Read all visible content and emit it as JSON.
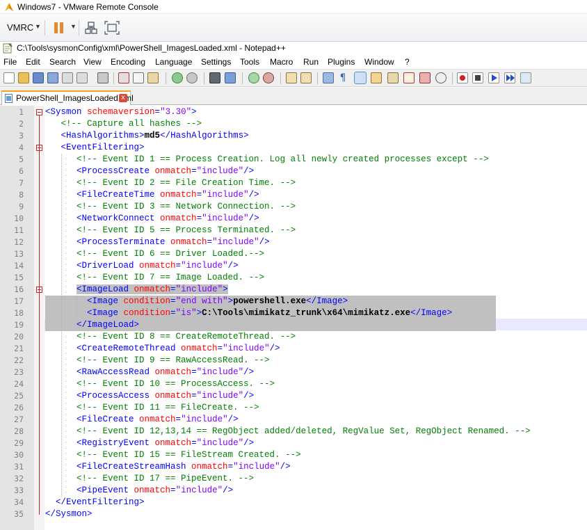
{
  "vm": {
    "title": "Windows7 - VMware Remote Console",
    "menu_label": "VMRC"
  },
  "npp": {
    "title": "C:\\Tools\\sysmonConfig\\xml\\PowerShell_ImagesLoaded.xml - Notepad++",
    "menu": [
      "File",
      "Edit",
      "Search",
      "View",
      "Encoding",
      "Language",
      "Settings",
      "Tools",
      "Macro",
      "Run",
      "Plugins",
      "Window",
      "?"
    ],
    "tab_label": "PowerShell_ImagesLoaded.xml",
    "tab_close": "x"
  },
  "colors": {
    "tag": "#0000ff",
    "attr": "#ff0000",
    "string": "#8000ff",
    "comment": "#008000",
    "selection": "#c0c0c0",
    "current_line": "#e8e8ff"
  },
  "editor": {
    "lines": [
      {
        "n": "1",
        "indent": 0,
        "segs": [
          [
            "t",
            "<Sysmon "
          ],
          [
            "a",
            "schemaversion"
          ],
          [
            "t",
            "="
          ],
          [
            "s",
            "\"3.30\""
          ],
          [
            "t",
            ">"
          ]
        ]
      },
      {
        "n": "2",
        "indent": 3,
        "segs": [
          [
            "c",
            "<!-- Capture all hashes -->"
          ]
        ]
      },
      {
        "n": "3",
        "indent": 3,
        "segs": [
          [
            "t",
            "<HashAlgorithms>"
          ],
          [
            "x",
            "md5"
          ],
          [
            "t",
            "</HashAlgorithms>"
          ]
        ]
      },
      {
        "n": "4",
        "indent": 3,
        "segs": [
          [
            "t",
            "<EventFiltering>"
          ]
        ]
      },
      {
        "n": "5",
        "indent": 6,
        "segs": [
          [
            "c",
            "<!-- Event ID 1 == Process Creation. Log all newly created processes except -->"
          ]
        ]
      },
      {
        "n": "6",
        "indent": 6,
        "segs": [
          [
            "t",
            "<ProcessCreate "
          ],
          [
            "a",
            "onmatch"
          ],
          [
            "t",
            "="
          ],
          [
            "s",
            "\"include\""
          ],
          [
            "t",
            "/>"
          ]
        ]
      },
      {
        "n": "7",
        "indent": 6,
        "segs": [
          [
            "c",
            "<!-- Event ID 2 == File Creation Time. -->"
          ]
        ]
      },
      {
        "n": "8",
        "indent": 6,
        "segs": [
          [
            "t",
            "<FileCreateTime "
          ],
          [
            "a",
            "onmatch"
          ],
          [
            "t",
            "="
          ],
          [
            "s",
            "\"include\""
          ],
          [
            "t",
            "/>"
          ]
        ]
      },
      {
        "n": "9",
        "indent": 6,
        "segs": [
          [
            "c",
            "<!-- Event ID 3 == Network Connection. -->"
          ]
        ]
      },
      {
        "n": "10",
        "indent": 6,
        "segs": [
          [
            "t",
            "<NetworkConnect "
          ],
          [
            "a",
            "onmatch"
          ],
          [
            "t",
            "="
          ],
          [
            "s",
            "\"include\""
          ],
          [
            "t",
            "/>"
          ]
        ]
      },
      {
        "n": "11",
        "indent": 6,
        "segs": [
          [
            "c",
            "<!-- Event ID 5 == Process Terminated. -->"
          ]
        ]
      },
      {
        "n": "12",
        "indent": 6,
        "segs": [
          [
            "t",
            "<ProcessTerminate "
          ],
          [
            "a",
            "onmatch"
          ],
          [
            "t",
            "="
          ],
          [
            "s",
            "\"include\""
          ],
          [
            "t",
            "/>"
          ]
        ]
      },
      {
        "n": "13",
        "indent": 6,
        "segs": [
          [
            "c",
            "<!-- Event ID 6 == Driver Loaded.-->"
          ]
        ]
      },
      {
        "n": "14",
        "indent": 6,
        "segs": [
          [
            "t",
            "<DriverLoad "
          ],
          [
            "a",
            "onmatch"
          ],
          [
            "t",
            "="
          ],
          [
            "s",
            "\"include\""
          ],
          [
            "t",
            "/>"
          ]
        ]
      },
      {
        "n": "15",
        "indent": 6,
        "segs": [
          [
            "c",
            "<!-- Event ID 7 == Image Loaded. -->"
          ]
        ]
      },
      {
        "n": "16",
        "indent": 6,
        "sel": "text",
        "segs": [
          [
            "t",
            "<ImageLoad "
          ],
          [
            "a",
            "onmatch"
          ],
          [
            "t",
            "="
          ],
          [
            "s",
            "\"include\""
          ],
          [
            "t",
            ">"
          ]
        ]
      },
      {
        "n": "17",
        "indent": 0,
        "sel": "full",
        "segs": [
          [
            "x",
            "        "
          ],
          [
            "t",
            "<Image "
          ],
          [
            "a",
            "condition"
          ],
          [
            "t",
            "="
          ],
          [
            "s",
            "\"end with\""
          ],
          [
            "t",
            ">"
          ],
          [
            "x",
            "powershell.exe"
          ],
          [
            "t",
            "</Image>"
          ]
        ]
      },
      {
        "n": "18",
        "indent": 0,
        "sel": "full",
        "segs": [
          [
            "x",
            "        "
          ],
          [
            "t",
            "<Image "
          ],
          [
            "a",
            "condition"
          ],
          [
            "t",
            "="
          ],
          [
            "s",
            "\"is\""
          ],
          [
            "t",
            ">"
          ],
          [
            "x",
            "C:\\Tools\\mimikatz_trunk\\x64\\mimikatz.exe"
          ],
          [
            "t",
            "</Image>"
          ]
        ]
      },
      {
        "n": "19",
        "indent": 0,
        "sel": "full",
        "segs": [
          [
            "x",
            "      "
          ],
          [
            "t",
            "</ImageLoad>"
          ]
        ]
      },
      {
        "n": "20",
        "indent": 6,
        "segs": [
          [
            "c",
            "<!-- Event ID 8 == CreateRemoteThread. -->"
          ]
        ]
      },
      {
        "n": "21",
        "indent": 6,
        "segs": [
          [
            "t",
            "<CreateRemoteThread "
          ],
          [
            "a",
            "onmatch"
          ],
          [
            "t",
            "="
          ],
          [
            "s",
            "\"include\""
          ],
          [
            "t",
            "/>"
          ]
        ]
      },
      {
        "n": "22",
        "indent": 6,
        "segs": [
          [
            "c",
            "<!-- Event ID 9 == RawAccessRead. -->"
          ]
        ]
      },
      {
        "n": "23",
        "indent": 6,
        "segs": [
          [
            "t",
            "<RawAccessRead "
          ],
          [
            "a",
            "onmatch"
          ],
          [
            "t",
            "="
          ],
          [
            "s",
            "\"include\""
          ],
          [
            "t",
            "/>"
          ]
        ]
      },
      {
        "n": "24",
        "indent": 6,
        "segs": [
          [
            "c",
            "<!-- Event ID 10 == ProcessAccess. -->"
          ]
        ]
      },
      {
        "n": "25",
        "indent": 6,
        "segs": [
          [
            "t",
            "<ProcessAccess "
          ],
          [
            "a",
            "onmatch"
          ],
          [
            "t",
            "="
          ],
          [
            "s",
            "\"include\""
          ],
          [
            "t",
            "/>"
          ]
        ]
      },
      {
        "n": "26",
        "indent": 6,
        "segs": [
          [
            "c",
            "<!-- Event ID 11 == FileCreate. -->"
          ]
        ]
      },
      {
        "n": "27",
        "indent": 6,
        "segs": [
          [
            "t",
            "<FileCreate "
          ],
          [
            "a",
            "onmatch"
          ],
          [
            "t",
            "="
          ],
          [
            "s",
            "\"include\""
          ],
          [
            "t",
            "/>"
          ]
        ]
      },
      {
        "n": "28",
        "indent": 6,
        "segs": [
          [
            "c",
            "<!-- Event ID 12,13,14 == RegObject added/deleted, RegValue Set, RegObject Renamed. -->"
          ]
        ]
      },
      {
        "n": "29",
        "indent": 6,
        "segs": [
          [
            "t",
            "<RegistryEvent "
          ],
          [
            "a",
            "onmatch"
          ],
          [
            "t",
            "="
          ],
          [
            "s",
            "\"include\""
          ],
          [
            "t",
            "/>"
          ]
        ]
      },
      {
        "n": "30",
        "indent": 6,
        "segs": [
          [
            "c",
            "<!-- Event ID 15 == FileStream Created. -->"
          ]
        ]
      },
      {
        "n": "31",
        "indent": 6,
        "segs": [
          [
            "t",
            "<FileCreateStreamHash "
          ],
          [
            "a",
            "onmatch"
          ],
          [
            "t",
            "="
          ],
          [
            "s",
            "\"include\""
          ],
          [
            "t",
            "/>"
          ]
        ]
      },
      {
        "n": "32",
        "indent": 6,
        "segs": [
          [
            "c",
            "<!-- Event ID 17 == PipeEvent. -->"
          ]
        ]
      },
      {
        "n": "33",
        "indent": 6,
        "segs": [
          [
            "t",
            "<PipeEvent "
          ],
          [
            "a",
            "onmatch"
          ],
          [
            "t",
            "="
          ],
          [
            "s",
            "\"include\""
          ],
          [
            "t",
            "/>"
          ]
        ]
      },
      {
        "n": "34",
        "indent": 2,
        "segs": [
          [
            "t",
            "</EventFiltering>"
          ]
        ]
      },
      {
        "n": "35",
        "indent": 0,
        "segs": [
          [
            "t",
            "</Sysmon>"
          ]
        ]
      }
    ]
  }
}
